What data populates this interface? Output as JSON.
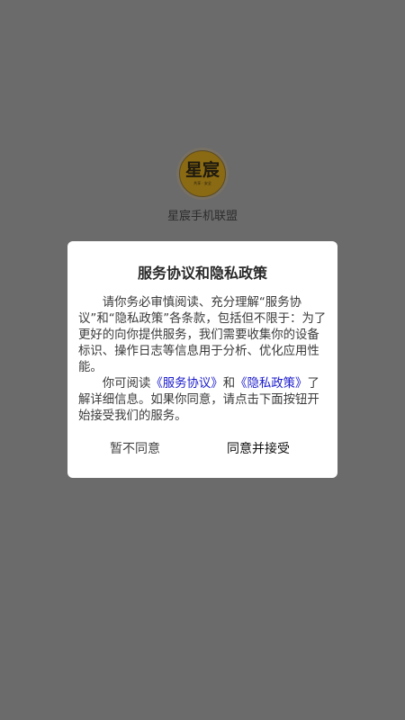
{
  "app": {
    "logo_text": "星宸",
    "logo_sub": "共享 · 安全",
    "name": "星宸手机联盟"
  },
  "dialog": {
    "title": "服务协议和隐私政策",
    "para1": "请你务必审慎阅读、充分理解“服务协议”和“隐私政策”各条款，包括但不限于：为了更好的向你提供服务，我们需要收集你的设备标识、操作日志等信息用于分析、优化应用性能。",
    "para2_prefix": "你可阅读",
    "link_service": "《服务协议》",
    "para2_and": "和",
    "link_privacy": "《隐私政策》",
    "para2_suffix": "了解详细信息。如果你同意，请点击下面按钮开始接受我们的服务。",
    "reject_label": "暂不同意",
    "accept_label": "同意并接受"
  },
  "colors": {
    "overlay": "#6b6b6b",
    "link": "#1a1acc",
    "logo_gold": "#8a6a12"
  }
}
